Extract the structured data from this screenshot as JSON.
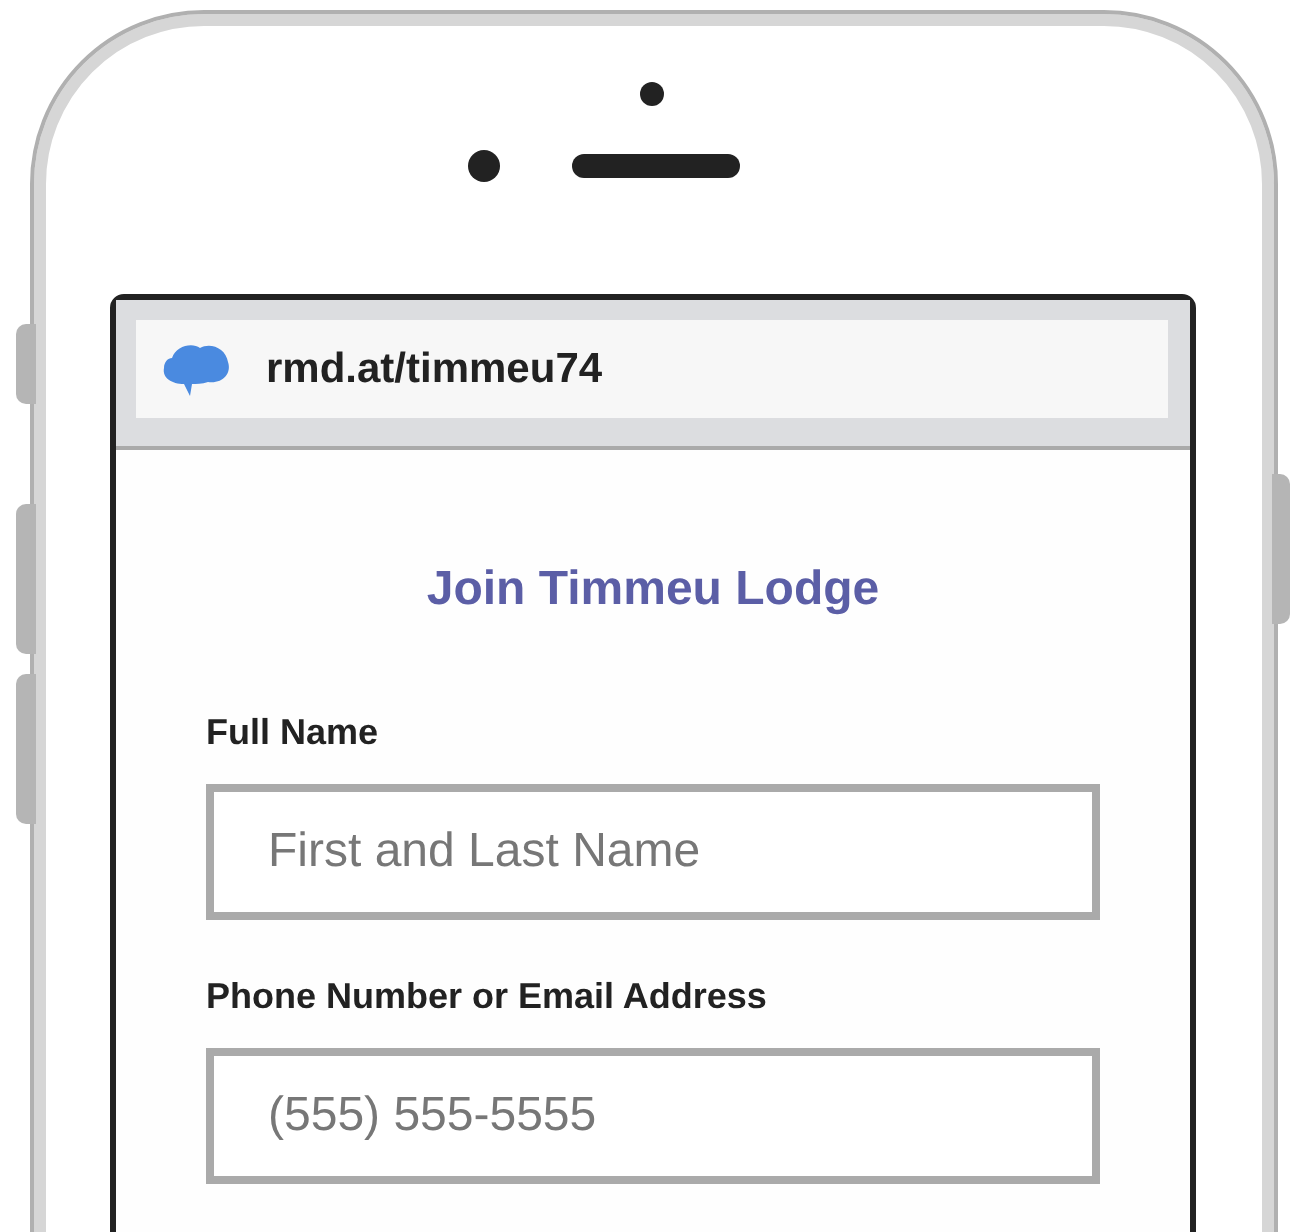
{
  "browser": {
    "url": "rmd.at/timmeu74"
  },
  "form": {
    "title": "Join Timmeu Lodge",
    "fields": [
      {
        "label": "Full Name",
        "placeholder": "First and Last Name"
      },
      {
        "label": "Phone Number or Email Address",
        "placeholder": "(555) 555-5555"
      }
    ]
  }
}
